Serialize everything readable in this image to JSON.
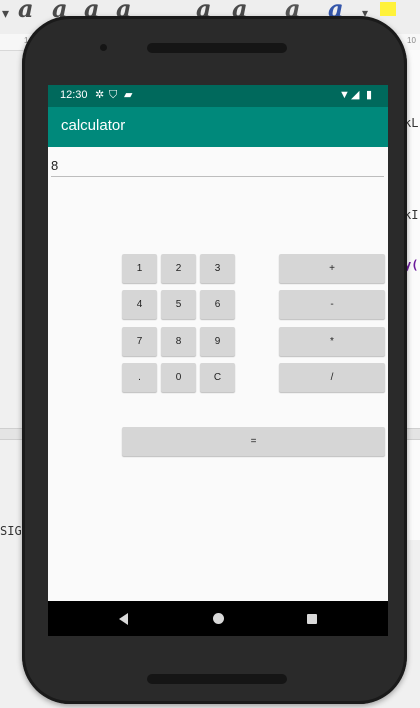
{
  "background_editor": {
    "toolbar_glyphs": [
      "a",
      "a",
      "a",
      "a",
      "a",
      "a",
      "a",
      "a"
    ],
    "ruler_numbers": [
      "1",
      "10"
    ],
    "code_fragments": [
      "}",
      "SIG",
      "kL",
      "kI",
      "y("
    ]
  },
  "status_bar": {
    "time": "12:30"
  },
  "app": {
    "title": "calculator"
  },
  "display": {
    "value": "8"
  },
  "keypad": {
    "digits": [
      "1",
      "2",
      "3",
      "4",
      "5",
      "6",
      "7",
      "8",
      "9",
      ".",
      "0",
      "C"
    ],
    "operators": [
      "+",
      "-",
      "*",
      "/"
    ],
    "equals": "="
  },
  "colors": {
    "status_bar": "#00695c",
    "app_bar": "#00897b",
    "button": "#d6d6d6",
    "nav_bar": "#000000"
  },
  "icons": {
    "status": [
      "settings-icon",
      "shield-icon",
      "sd-card-icon",
      "wifi-icon",
      "signal-icon",
      "battery-icon"
    ],
    "nav": [
      "back-icon",
      "home-icon",
      "recents-icon"
    ]
  }
}
